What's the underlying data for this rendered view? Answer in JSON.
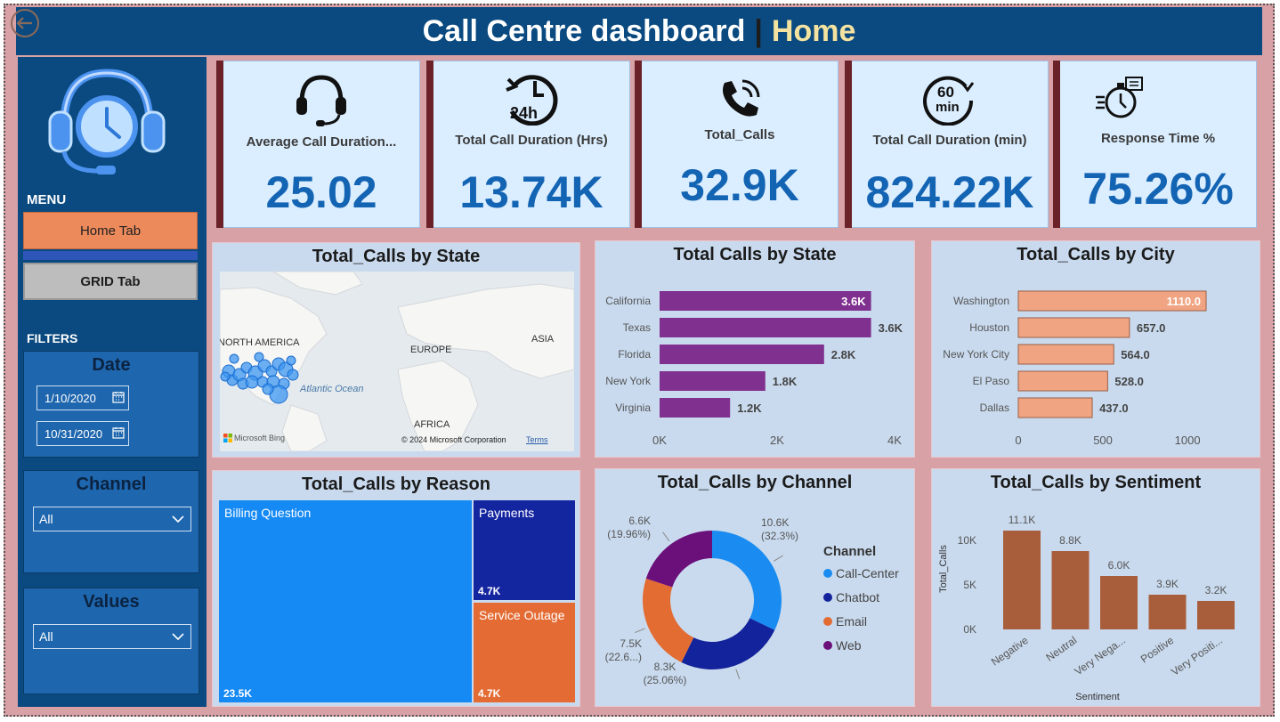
{
  "header": {
    "title": "Call Centre dashboard",
    "separator": "|",
    "page": "Home"
  },
  "sidebar": {
    "menu_label": "MENU",
    "tabs": [
      {
        "label": "Home Tab"
      },
      {
        "label": "GRID Tab"
      }
    ],
    "filters_label": "FILTERS",
    "date": {
      "title": "Date",
      "start": "1/10/2020",
      "end": "10/31/2020"
    },
    "channel": {
      "title": "Channel",
      "selected": "All"
    },
    "values": {
      "title": "Values",
      "selected": "All"
    }
  },
  "kpis": [
    {
      "label": "Average Call Duration...",
      "value": "25.02",
      "icon": "headset-icon"
    },
    {
      "label": "Total Call Duration (Hrs)",
      "value": "13.74K",
      "icon": "24h-clock-icon"
    },
    {
      "label": "Total_Calls",
      "value": "32.9K",
      "icon": "phone-ringing-icon"
    },
    {
      "label": "Total Call Duration (min)",
      "value": "824.22K",
      "icon": "60-min-icon"
    },
    {
      "label": "Response Time %",
      "value": "75.26%",
      "icon": "stopwatch-icon"
    }
  ],
  "map_panel": {
    "title": "Total_Calls by State",
    "labels": {
      "north_america": "NORTH AMERICA",
      "europe": "EUROPE",
      "asia": "ASIA",
      "africa": "AFRICA",
      "ocean": "Atlantic Ocean"
    },
    "attribution": "© 2024 Microsoft Corporation",
    "terms": "Terms",
    "brand": "Microsoft Bing"
  },
  "chart_data": [
    {
      "type": "bar",
      "orientation": "horizontal",
      "title": "Total Calls by State",
      "categories": [
        "California",
        "Texas",
        "Florida",
        "New York",
        "Virginia"
      ],
      "values": [
        3600,
        3600,
        2800,
        1800,
        1200
      ],
      "labels": [
        "3.6K",
        "3.6K",
        "2.8K",
        "1.8K",
        "1.2K"
      ],
      "xticks": [
        "0K",
        "2K",
        "4K"
      ],
      "xlim": [
        0,
        4000
      ],
      "color": "#80308f"
    },
    {
      "type": "bar",
      "orientation": "horizontal",
      "title": "Total_Calls by City",
      "categories": [
        "Washington",
        "Houston",
        "New York City",
        "El Paso",
        "Dallas"
      ],
      "values": [
        1110.0,
        657.0,
        564.0,
        528.0,
        437.0
      ],
      "labels": [
        "1110.0",
        "657.0",
        "564.0",
        "528.0",
        "437.0"
      ],
      "xticks": [
        "0",
        "500",
        "1000"
      ],
      "xlim": [
        0,
        1110
      ],
      "color": "#f0a482"
    },
    {
      "type": "table",
      "subtype": "treemap",
      "title": "Total_Calls by Reason",
      "categories": [
        "Billing Question",
        "Payments",
        "Service Outage"
      ],
      "values": [
        23500,
        4700,
        4700
      ],
      "labels": [
        "23.5K",
        "4.7K",
        "4.7K"
      ],
      "colors": [
        "#1589f4",
        "#1425a0",
        "#e46c34"
      ]
    },
    {
      "type": "pie",
      "donut": true,
      "title": "Total_Calls by Channel",
      "legend_title": "Channel",
      "legend_position": "right",
      "categories": [
        "Call-Center",
        "Chatbot",
        "Email",
        "Web"
      ],
      "values": [
        10600,
        8300,
        7500,
        6600
      ],
      "labels": [
        "10.6K",
        "8.3K",
        "7.5K",
        "6.6K"
      ],
      "percent_labels": [
        "(32.3%)",
        "(25.06%)",
        "(22.6...)",
        "(19.96%)"
      ],
      "colors": [
        "#1a8cf1",
        "#13239b",
        "#e36c33",
        "#6b0f7a"
      ]
    },
    {
      "type": "bar",
      "title": "Total_Calls by Sentiment",
      "categories": [
        "Negative",
        "Neutral",
        "Very Nega...",
        "Positive",
        "Very Positi..."
      ],
      "values": [
        11100,
        8800,
        6000,
        3900,
        3200
      ],
      "labels": [
        "11.1K",
        "8.8K",
        "6.0K",
        "3.9K",
        "3.2K"
      ],
      "ylabel": "Total_Calls",
      "xlabel": "Sentiment",
      "yticks": [
        "0K",
        "5K",
        "10K"
      ],
      "ylim": [
        0,
        12000
      ],
      "color": "#a95e3b"
    }
  ],
  "colors": {
    "header_bg": "#0b4a80",
    "accent_home": "#f3e2a0",
    "kpi_value": "#1464b4",
    "background": "#d8a1a6"
  }
}
